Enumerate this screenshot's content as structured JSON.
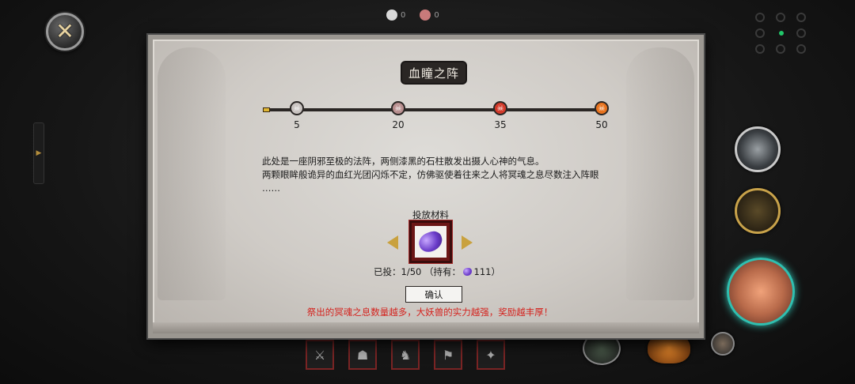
{
  "hud": {
    "close_icon": "close-icon",
    "counters": [
      {
        "icon": "white-skull-icon",
        "value": "0",
        "color": "#d9d9d9"
      },
      {
        "icon": "red-skull-icon",
        "value": "0",
        "color": "#c87a7a"
      }
    ],
    "left_handle_arrow": "▶"
  },
  "dialog": {
    "title": "血瞳之阵",
    "milestones": [
      {
        "value": "5",
        "color": "#c9c3c0"
      },
      {
        "value": "20",
        "color": "#b98f8f"
      },
      {
        "value": "35",
        "color": "#d23a2a"
      },
      {
        "value": "50",
        "color": "#e8731e"
      }
    ],
    "description": [
      "此处是一座阴邪至极的法阵，两侧漆黑的石柱散发出摄人心神的气息。",
      "两颗眼眸般诡异的血红光团闪烁不定，仿佛驱使着往来之人将冥魂之息尽数注入阵眼",
      "……"
    ],
    "material_label": "投放材料",
    "count_prefix": "已投：1/50 （持有：",
    "count_value": "111）",
    "confirm_label": "确认",
    "hint": "祭出的冥魂之息数量越多，大妖兽的实力越强，奖励越丰厚！",
    "colors": {
      "hint": "#d4231e",
      "slot_border": "#6b1616",
      "progress_start": "#e0b634"
    }
  },
  "bottom_bar": {
    "slots": [
      "⚔",
      "☗",
      "♞",
      "⚑",
      "✦"
    ]
  }
}
